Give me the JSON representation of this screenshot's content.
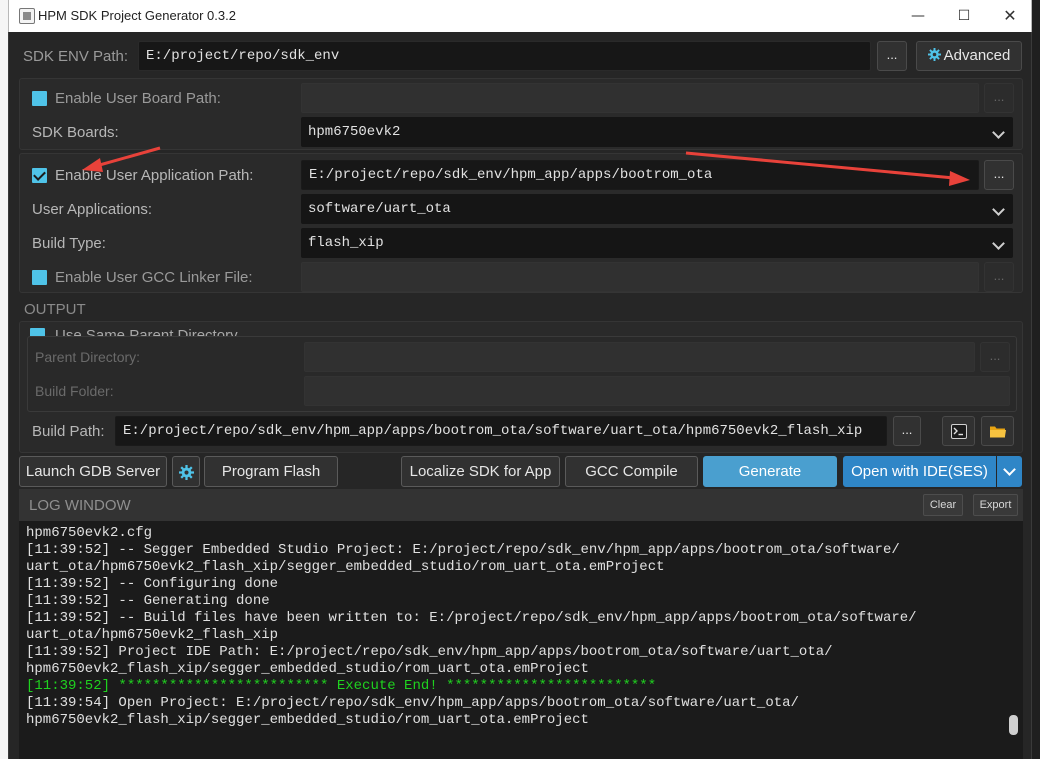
{
  "window": {
    "title": "HPM SDK Project Generator 0.3.2",
    "minimize_glyph": "—",
    "maximize_glyph": "☐",
    "close_glyph": "✕"
  },
  "sdk_env": {
    "label": "SDK ENV Path:",
    "value": "E:/project/repo/sdk_env",
    "browse_label": "...",
    "advanced_label": "Advanced",
    "advanced_icon": "gear-icon"
  },
  "board": {
    "enable_user_board_label": "Enable User Board Path:",
    "enable_user_board_checked": false,
    "browse_label": "...",
    "sdk_boards_label": "SDK Boards:",
    "sdk_boards_value": "hpm6750evk2"
  },
  "app": {
    "enable_user_app_label": "Enable User Application Path:",
    "enable_user_app_checked": true,
    "user_app_path": "E:/project/repo/sdk_env/hpm_app/apps/bootrom_ota",
    "browse_label": "...",
    "user_applications_label": "User Applications:",
    "user_applications_value": "software/uart_ota",
    "build_type_label": "Build Type:",
    "build_type_value": "flash_xip",
    "enable_gcc_linker_label": "Enable User GCC Linker File:",
    "enable_gcc_linker_checked": false,
    "gcc_browse_label": "..."
  },
  "output": {
    "section_label": "OUTPUT",
    "use_same_parent_label": "Use Same Parent Directory",
    "use_same_parent_checked": false,
    "parent_directory_label": "Parent Directory:",
    "parent_browse_label": "...",
    "build_folder_label": "Build Folder:",
    "build_path_label": "Build Path:",
    "build_path_value": "E:/project/repo/sdk_env/hpm_app/apps/bootrom_ota/software/uart_ota/hpm6750evk2_flash_xip",
    "build_path_browse_label": "...",
    "terminal_icon": "terminal-icon",
    "folder_icon": "folder-icon"
  },
  "actions": {
    "launch_gdb": "Launch GDB Server",
    "program_flash": "Program Flash",
    "localize_sdk": "Localize SDK for App",
    "gcc_compile": "GCC Compile",
    "generate": "Generate",
    "open_with_ide": "Open with IDE(SES)"
  },
  "log": {
    "title": "LOG WINDOW",
    "clear_label": "Clear",
    "export_label": "Export",
    "lines": [
      {
        "text": "hpm6750evk2.cfg",
        "green": false
      },
      {
        "text": "[11:39:52] -- Segger Embedded Studio Project: E:/project/repo/sdk_env/hpm_app/apps/bootrom_ota/software/",
        "green": false
      },
      {
        "text": "uart_ota/hpm6750evk2_flash_xip/segger_embedded_studio/rom_uart_ota.emProject",
        "green": false
      },
      {
        "text": "[11:39:52] -- Configuring done",
        "green": false
      },
      {
        "text": "[11:39:52] -- Generating done",
        "green": false
      },
      {
        "text": "[11:39:52] -- Build files have been written to: E:/project/repo/sdk_env/hpm_app/apps/bootrom_ota/software/",
        "green": false
      },
      {
        "text": "uart_ota/hpm6750evk2_flash_xip",
        "green": false
      },
      {
        "text": "[11:39:52] Project IDE Path: E:/project/repo/sdk_env/hpm_app/apps/bootrom_ota/software/uart_ota/",
        "green": false
      },
      {
        "text": "hpm6750evk2_flash_xip/segger_embedded_studio/rom_uart_ota.emProject",
        "green": false
      },
      {
        "text": "[11:39:52] ************************* Execute End! *************************",
        "green": true
      },
      {
        "text": "[11:39:54] Open Project: E:/project/repo/sdk_env/hpm_app/apps/bootrom_ota/software/uart_ota/",
        "green": false
      },
      {
        "text": "hpm6750evk2_flash_xip/segger_embedded_studio/rom_uart_ota.emProject",
        "green": false
      }
    ]
  },
  "colors": {
    "accent": "#4fc3e8",
    "generate_bg": "#4a9fcf",
    "open_ide_bg": "#2f86c7",
    "log_green": "#1fd21f",
    "annotation_red": "#e8423a"
  }
}
